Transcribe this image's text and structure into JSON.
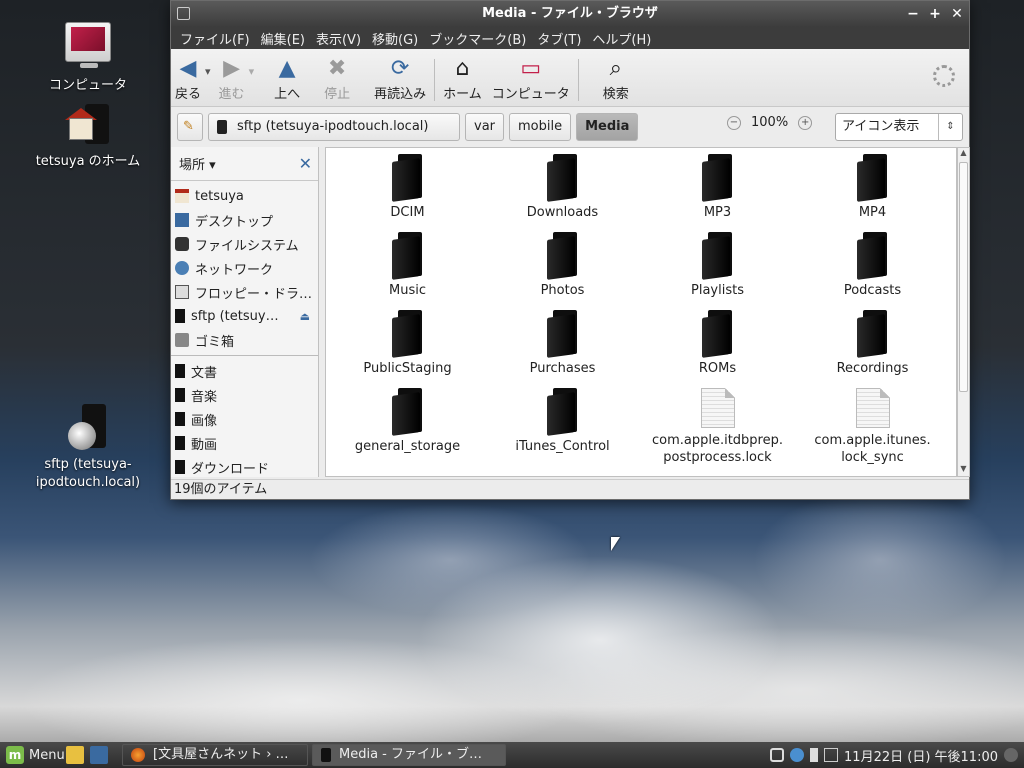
{
  "desktop": {
    "icons": [
      {
        "label": "コンピュータ",
        "icon": "computer-icon"
      },
      {
        "label": "tetsuya のホーム",
        "icon": "home-folder-icon"
      },
      {
        "label": "sftp (tetsuya-ipodtouch.local)",
        "icon": "network-drive-icon"
      }
    ]
  },
  "window": {
    "title": "Media - ファイル・ブラウザ",
    "controls": [
      "−",
      "+",
      "✕"
    ]
  },
  "menubar": [
    "ファイル(F)",
    "編集(E)",
    "表示(V)",
    "移動(G)",
    "ブックマーク(B)",
    "タブ(T)",
    "ヘルプ(H)"
  ],
  "toolbar": {
    "back": "戻る",
    "forward": "進む",
    "up": "上へ",
    "stop": "停止",
    "reload": "再読込み",
    "home": "ホーム",
    "computer": "コンピュータ",
    "search": "検索"
  },
  "location": {
    "path": [
      "sftp (tetsuya-ipodtouch.local)",
      "var",
      "mobile",
      "Media"
    ],
    "zoom": "100%",
    "view_mode": "アイコン表示"
  },
  "sidebar": {
    "header": "場所",
    "places": [
      {
        "label": "tetsuya",
        "icon": "home-icon"
      },
      {
        "label": "デスクトップ",
        "icon": "desktop-icon"
      },
      {
        "label": "ファイルシステム",
        "icon": "drive-icon"
      },
      {
        "label": "ネットワーク",
        "icon": "network-icon"
      },
      {
        "label": "フロッピー・ドラ…",
        "icon": "floppy-icon"
      },
      {
        "label": "sftp (tetsuy…",
        "icon": "sftp-icon"
      },
      {
        "label": "ゴミ箱",
        "icon": "trash-icon"
      }
    ],
    "bookmarks": [
      {
        "label": "文書",
        "icon": "folder-icon"
      },
      {
        "label": "音楽",
        "icon": "folder-icon"
      },
      {
        "label": "画像",
        "icon": "folder-icon"
      },
      {
        "label": "動画",
        "icon": "folder-icon"
      },
      {
        "label": "ダウンロード",
        "icon": "folder-icon"
      }
    ]
  },
  "files": [
    {
      "name": "DCIM",
      "type": "folder"
    },
    {
      "name": "Downloads",
      "type": "folder"
    },
    {
      "name": "MP3",
      "type": "folder"
    },
    {
      "name": "MP4",
      "type": "folder"
    },
    {
      "name": "Music",
      "type": "folder"
    },
    {
      "name": "Photos",
      "type": "folder"
    },
    {
      "name": "Playlists",
      "type": "folder"
    },
    {
      "name": "Podcasts",
      "type": "folder"
    },
    {
      "name": "PublicStaging",
      "type": "folder"
    },
    {
      "name": "Purchases",
      "type": "folder"
    },
    {
      "name": "ROMs",
      "type": "folder"
    },
    {
      "name": "Recordings",
      "type": "folder"
    },
    {
      "name": "general_storage",
      "type": "folder"
    },
    {
      "name": "iTunes_Control",
      "type": "folder"
    },
    {
      "name": "com.apple.itdbprep.\npostprocess.lock",
      "type": "file"
    },
    {
      "name": "com.apple.itunes.\nlock_sync",
      "type": "file"
    }
  ],
  "status": "19個のアイテム",
  "taskbar": {
    "menu": "Menu",
    "tasks": [
      "[文具屋さんネット › …",
      "Media - ファイル・ブ…"
    ],
    "clock": "11月22日 (日) 午後11:00"
  },
  "colors": {
    "menubar": "#3c3c3c",
    "accent": "#3a6aa0",
    "mint": "#7cbc4a"
  }
}
